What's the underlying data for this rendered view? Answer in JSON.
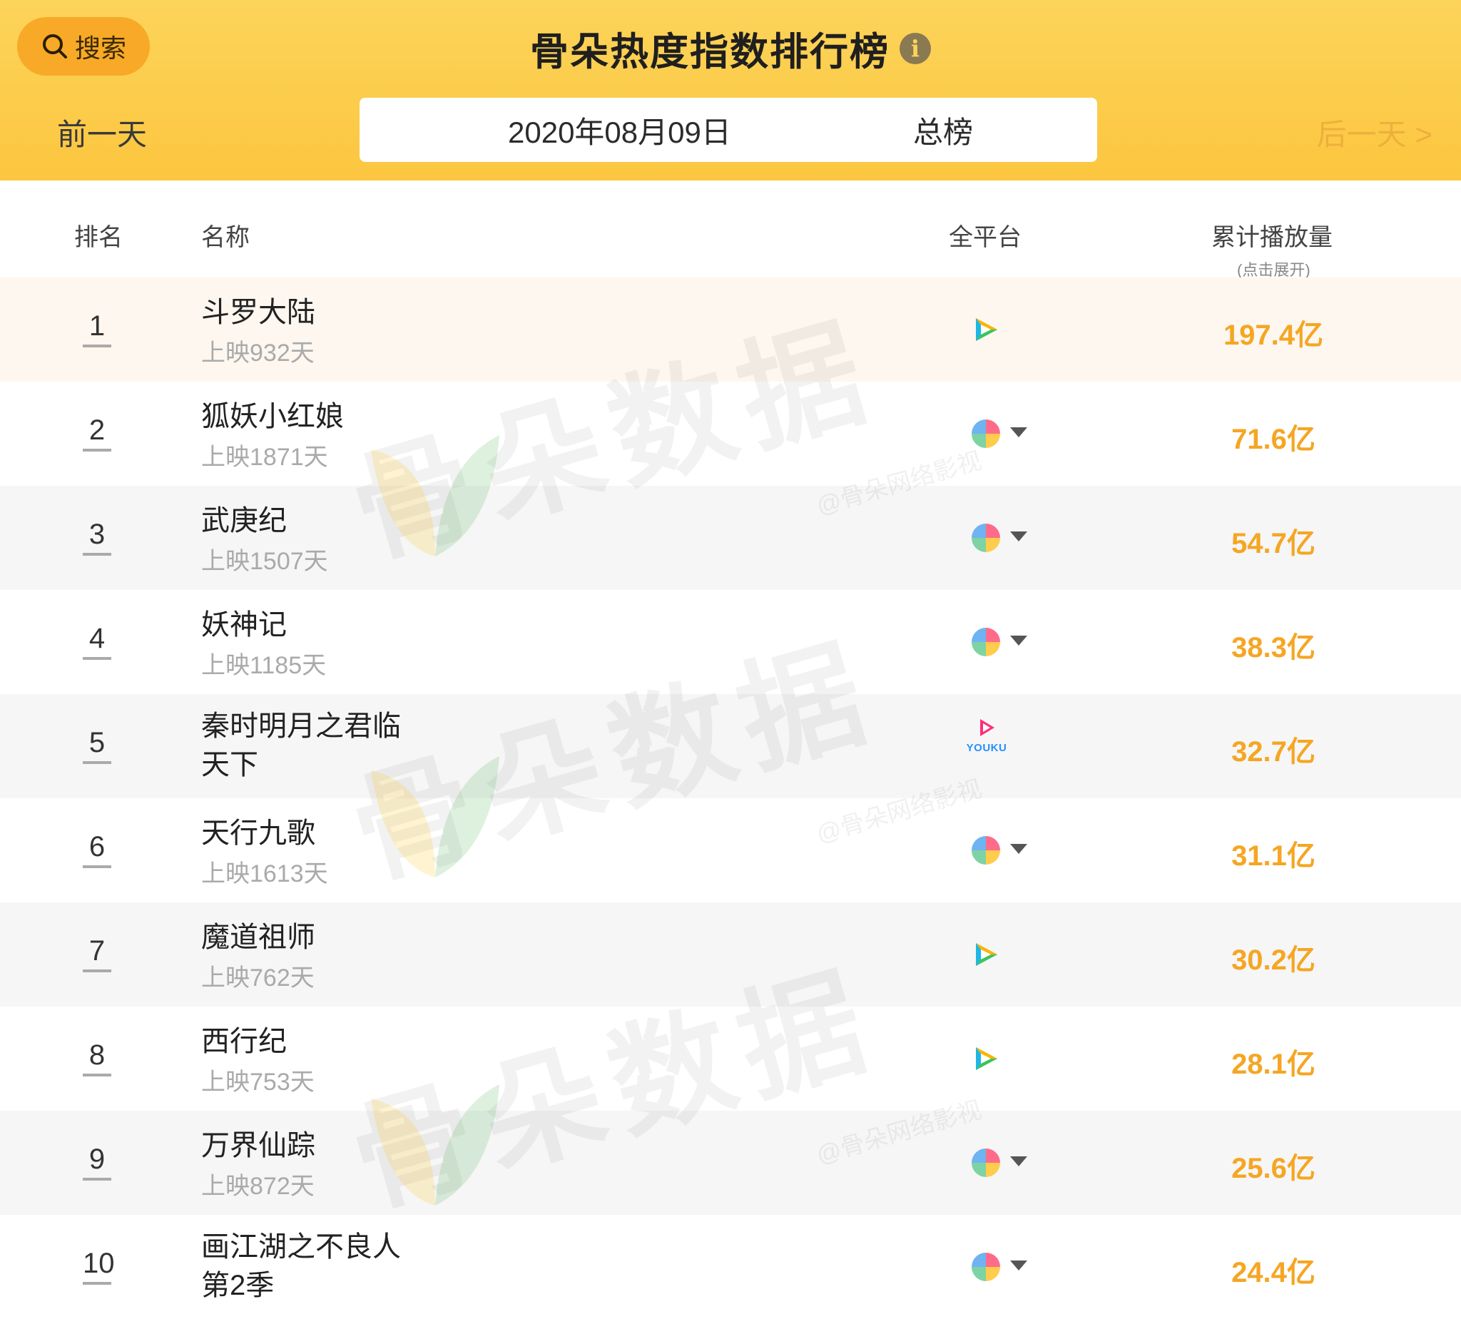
{
  "header": {
    "search_label": "搜索",
    "title": "骨朵热度指数排行榜",
    "prev_day": "前一天",
    "next_day": "后一天 >",
    "date": "2020年08月09日",
    "board": "总榜"
  },
  "table": {
    "columns": {
      "rank": "排名",
      "name": "名称",
      "platform": "全平台",
      "plays": "累计播放量",
      "plays_hint": "(点击展开)"
    },
    "rows": [
      {
        "rank": "1",
        "name": "斗罗大陆",
        "sub": "上映932天",
        "platform": "tencent-video-icon",
        "plays": "197.4亿"
      },
      {
        "rank": "2",
        "name": "狐妖小红娘",
        "sub": "上映1871天",
        "platform": "multi-platform-icon",
        "plays": "71.6亿"
      },
      {
        "rank": "3",
        "name": "武庚纪",
        "sub": "上映1507天",
        "platform": "multi-platform-icon",
        "plays": "54.7亿"
      },
      {
        "rank": "4",
        "name": "妖神记",
        "sub": "上映1185天",
        "platform": "multi-platform-icon",
        "plays": "38.3亿"
      },
      {
        "rank": "5",
        "name": "秦时明月之君临天下",
        "sub": "",
        "platform": "youku-icon",
        "plays": "32.7亿"
      },
      {
        "rank": "6",
        "name": "天行九歌",
        "sub": "上映1613天",
        "platform": "multi-platform-icon",
        "plays": "31.1亿"
      },
      {
        "rank": "7",
        "name": "魔道祖师",
        "sub": "上映762天",
        "platform": "tencent-video-icon",
        "plays": "30.2亿"
      },
      {
        "rank": "8",
        "name": "西行纪",
        "sub": "上映753天",
        "platform": "tencent-video-icon",
        "plays": "28.1亿"
      },
      {
        "rank": "9",
        "name": "万界仙踪",
        "sub": "上映872天",
        "platform": "multi-platform-icon",
        "plays": "25.6亿"
      },
      {
        "rank": "10",
        "name": "画江湖之不良人第2季",
        "sub": "",
        "platform": "multi-platform-icon",
        "plays": "24.4亿"
      }
    ]
  },
  "youku_text": "YOUKU",
  "watermark": {
    "text": "骨朵数据",
    "sub": "@骨朵网络影视"
  },
  "colors": {
    "header": "#fcc63f",
    "accent": "#f5a623",
    "search_button": "#f7a927"
  }
}
